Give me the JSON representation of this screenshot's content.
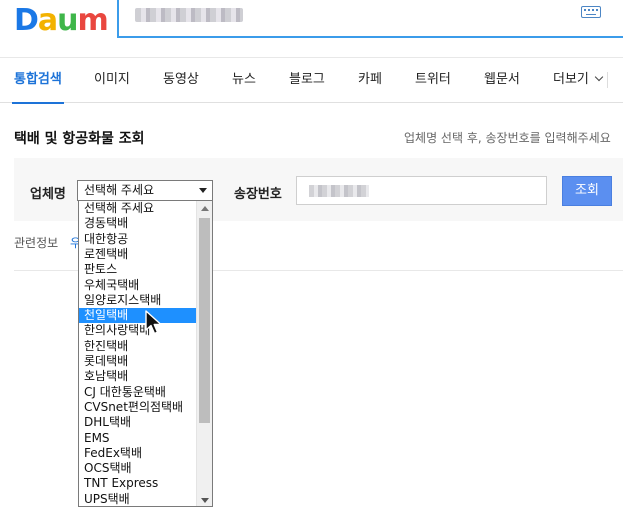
{
  "header": {
    "logo": {
      "letters": [
        "D",
        "a",
        "u",
        "m"
      ],
      "colors": [
        "#1a78e6",
        "#f3b200",
        "#3fb64a",
        "#e9473f"
      ]
    },
    "search": {
      "value_obscured": true,
      "keyboard_icon": "keyboard-icon"
    }
  },
  "tabs": [
    {
      "label": "통합검색",
      "active": true
    },
    {
      "label": "이미지"
    },
    {
      "label": "동영상"
    },
    {
      "label": "뉴스"
    },
    {
      "label": "블로그"
    },
    {
      "label": "카페"
    },
    {
      "label": "트위터"
    },
    {
      "label": "웹문서"
    },
    {
      "label": "더보기"
    }
  ],
  "section": {
    "title": "택배 및 항공화물 조회",
    "help": "업체명 선택 후, 송장번호를 입력해주세요"
  },
  "form": {
    "company_label": "업체명",
    "company_selected": "선택해 주세요",
    "invoice_label": "송장번호",
    "invoice_value_obscured": true,
    "submit_label": "조회"
  },
  "related": {
    "label": "관련정보",
    "link": "우"
  },
  "dropdown": {
    "highlighted_index": 7,
    "options": [
      "선택해 주세요",
      "경동택배",
      "대한항공",
      "로젠택배",
      "판토스",
      "우체국택배",
      "일양로지스택배",
      "천일택배",
      "한의사랑택배",
      "한진택배",
      "롯데택배",
      "호남택배",
      "CJ 대한통운택배",
      "CVSnet편의점택배",
      "DHL택배",
      "EMS",
      "FedEx택배",
      "OCS택배",
      "TNT Express",
      "UPS택배"
    ]
  },
  "colors": {
    "accent": "#1d73d8",
    "search_border": "#3b9cea",
    "button": "#5b8ff0",
    "highlight": "#1e90ff"
  }
}
